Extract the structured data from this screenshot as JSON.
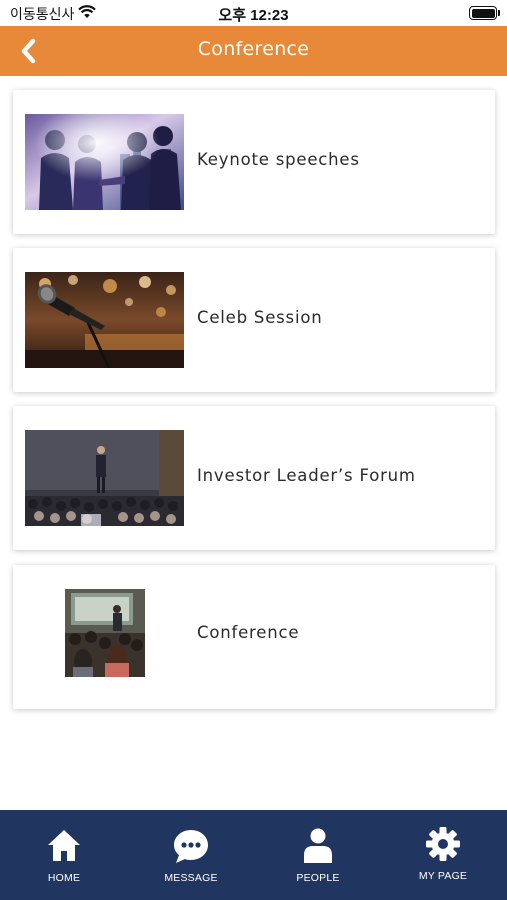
{
  "status_bar": {
    "carrier": "이동통신사",
    "time": "오후 12:23"
  },
  "header": {
    "title": "Conference",
    "back_icon": "chevron-left-icon",
    "background_color": "#e8893a"
  },
  "sessions": [
    {
      "label": "Keynote speeches",
      "image": "business-handshake-photo"
    },
    {
      "label": "Celeb Session",
      "image": "microphone-stage-photo"
    },
    {
      "label": "Investor Leader’s Forum",
      "image": "speaker-audience-photo"
    },
    {
      "label": "Conference",
      "image": "classroom-presentation-photo"
    }
  ],
  "bottom_nav": {
    "background_color": "#213561",
    "items": [
      {
        "label": "HOME",
        "icon": "home-icon"
      },
      {
        "label": "MESSAGE",
        "icon": "chat-bubble-icon"
      },
      {
        "label": "PEOPLE",
        "icon": "person-icon"
      },
      {
        "label": "MY PAGE",
        "icon": "gear-icon"
      }
    ]
  }
}
